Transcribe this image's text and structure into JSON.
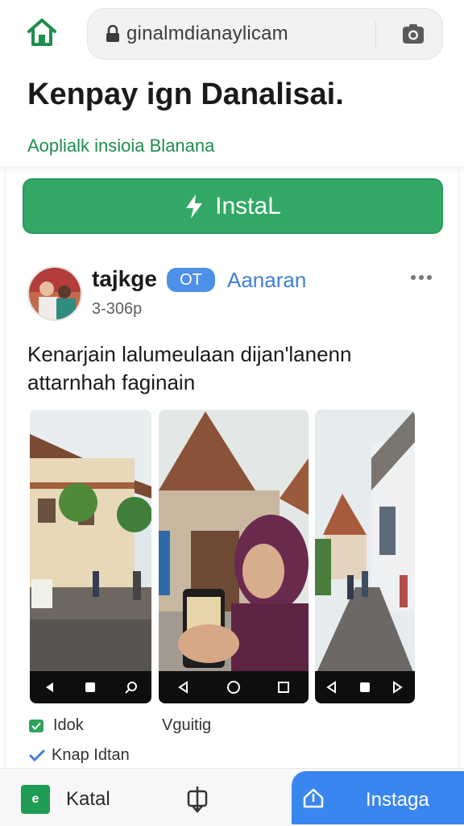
{
  "browser": {
    "url": "ginalmdianaylicam"
  },
  "page": {
    "title": "Kenpay ign Danalisai.",
    "subtitle": "Aoplialk insioia Blanana",
    "install_button": "InstaL"
  },
  "post": {
    "username": "tajkge",
    "badge": "OT",
    "follow": "Aanaran",
    "time": "3-306p",
    "text": "Kenarjain lalumeulaan dijan'lanenn attarnhah faginain"
  },
  "captions": {
    "first": "Idok",
    "second": "Vguitig",
    "third": "Knap Idtan"
  },
  "bottom_bar": {
    "catalog_label": "Katal",
    "catalog_icon_text": "e",
    "install_label": "Instaga"
  },
  "colors": {
    "accent_green": "#33a866",
    "link_blue": "#3f7fd9",
    "tab_blue": "#3a86f0",
    "badge_blue": "#4e8fe8"
  },
  "icons": [
    "home-icon",
    "lock-icon",
    "camera-icon",
    "bolt-icon",
    "more-icon",
    "check-icon",
    "share-icon",
    "install-tab-icon",
    "back-nav-icon",
    "home-nav-icon",
    "recents-nav-icon"
  ]
}
